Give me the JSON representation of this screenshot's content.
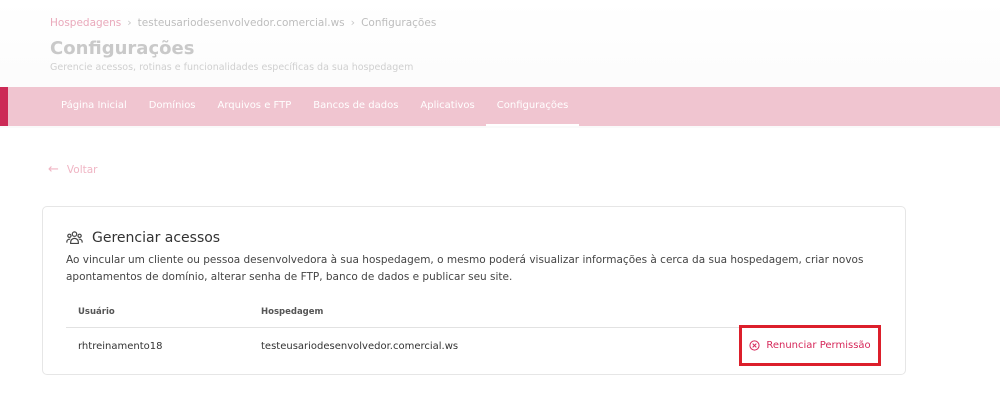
{
  "breadcrumb": {
    "items": [
      "Hospedagens",
      "testeusariodesenvolvedor.comercial.ws",
      "Configurações"
    ]
  },
  "page": {
    "title": "Configurações",
    "subtitle": "Gerencie acessos, rotinas e funcionalidades específicas da sua hospedagem"
  },
  "tabs": [
    {
      "label": "Página Inicial"
    },
    {
      "label": "Domínios"
    },
    {
      "label": "Arquivos e FTP"
    },
    {
      "label": "Bancos de dados"
    },
    {
      "label": "Aplicativos"
    },
    {
      "label": "Configurações",
      "active": true
    }
  ],
  "back": {
    "label": "Voltar"
  },
  "access_card": {
    "title": "Gerenciar acessos",
    "description": "Ao vincular um cliente ou pessoa desenvolvedora à sua hospedagem, o mesmo poderá visualizar informações à cerca da sua hospedagem, criar novos apontamentos de domínio, alterar senha de FTP, banco de dados e publicar seu site.",
    "columns": {
      "user": "Usuário",
      "host": "Hospedagem"
    },
    "rows": [
      {
        "user": "rhtreinamento18",
        "host": "testeusariodesenvolvedor.comercial.ws",
        "action": "Renunciar Permissão"
      }
    ]
  },
  "colors": {
    "accent": "#cc2a56",
    "tabbar": "#f0c5d0",
    "highlight_border": "#dc1f2b"
  }
}
